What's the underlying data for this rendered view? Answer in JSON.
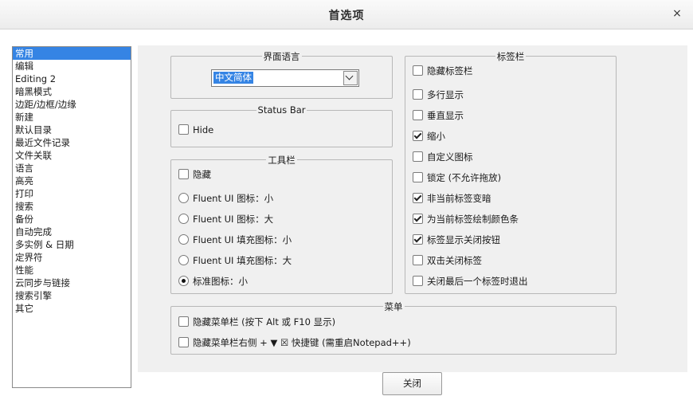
{
  "window": {
    "title": "首选项",
    "close_symbol": "×"
  },
  "nav": {
    "selected_index": 0,
    "items": [
      "常用",
      "编辑",
      "Editing 2",
      "暗黑模式",
      "边距/边框/边缘",
      "新建",
      "默认目录",
      "最近文件记录",
      "文件关联",
      "语言",
      "高亮",
      "打印",
      "搜索",
      "备份",
      "自动完成",
      "多实例 & 日期",
      "定界符",
      "性能",
      "云同步与链接",
      "搜索引擎",
      "其它"
    ]
  },
  "language_group": {
    "title": "界面语言",
    "selected": "中文简体"
  },
  "status_bar_group": {
    "title": "Status Bar",
    "hide_label": "Hide",
    "hide_checked": false
  },
  "toolbar_group": {
    "title": "工具栏",
    "hide_label": "隐藏",
    "hide_checked": false,
    "options": [
      {
        "label": "Fluent UI 图标：小",
        "selected": false
      },
      {
        "label": "Fluent UI 图标：大",
        "selected": false
      },
      {
        "label": "Fluent UI 填充图标：小",
        "selected": false
      },
      {
        "label": "Fluent UI 填充图标：大",
        "selected": false
      },
      {
        "label": "标准图标：小",
        "selected": true
      }
    ]
  },
  "tabbar_group": {
    "title": "标签栏",
    "items": [
      {
        "label": "隐藏标签栏",
        "checked": false
      },
      {
        "label": "多行显示",
        "checked": false
      },
      {
        "label": "垂直显示",
        "checked": false
      },
      {
        "label": "缩小",
        "checked": true
      },
      {
        "label": "自定义图标",
        "checked": false
      },
      {
        "label": "锁定 (不允许拖放)",
        "checked": false
      },
      {
        "label": "非当前标签变暗",
        "checked": true
      },
      {
        "label": "为当前标签绘制颜色条",
        "checked": true
      },
      {
        "label": "标签显示关闭按钮",
        "checked": true
      },
      {
        "label": "双击关闭标签",
        "checked": false
      },
      {
        "label": "关闭最后一个标签时退出",
        "checked": false
      }
    ]
  },
  "menu_group": {
    "title": "菜单",
    "items": [
      {
        "label": "隐藏菜单栏 (按下 Alt 或 F10 显示)",
        "checked": false
      },
      {
        "label": "隐藏菜单栏右侧 + ▼ ☒ 快捷键 (需重启Notepad++)",
        "checked": false
      }
    ]
  },
  "buttons": {
    "close": "关闭"
  }
}
